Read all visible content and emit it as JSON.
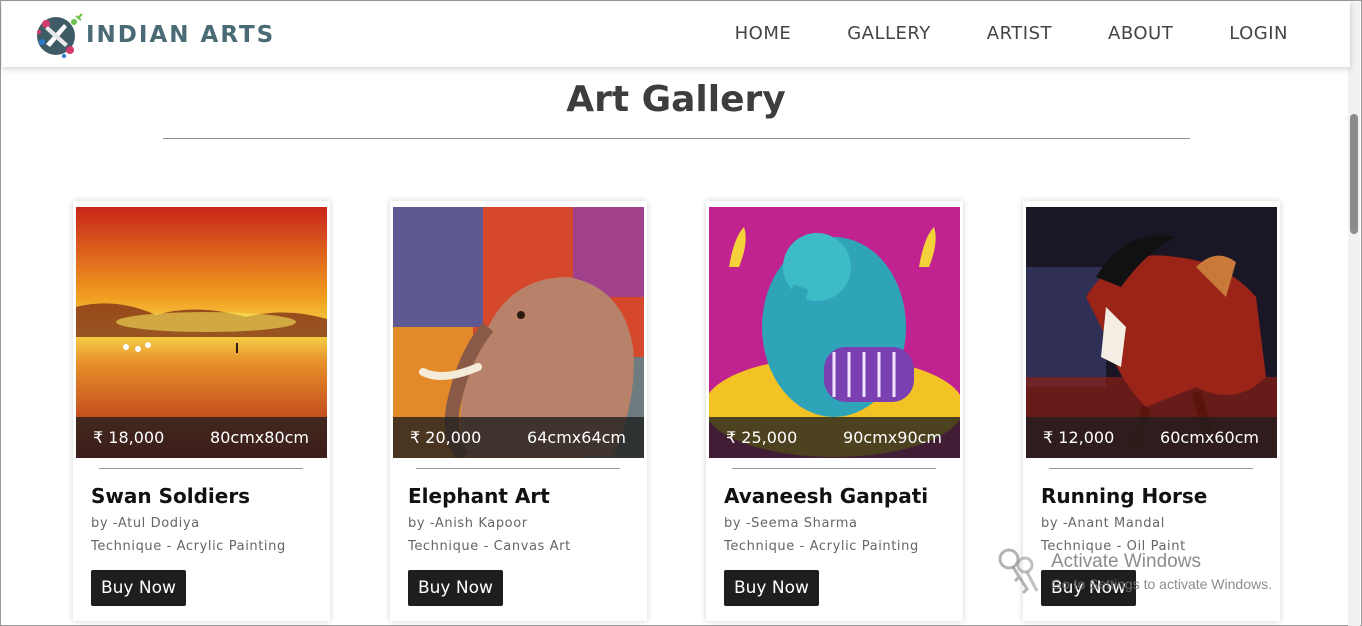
{
  "header": {
    "logo_text": "INDIAN ARTS",
    "nav": [
      "HOME",
      "GALLERY",
      "ARTIST",
      "ABOUT",
      "LOGIN"
    ]
  },
  "page": {
    "title": "Art Gallery"
  },
  "cards": [
    {
      "price": "₹ 18,000",
      "size": "80cmx80cm",
      "title": "Swan Soldiers",
      "artist": "by -Atul Dodiya",
      "technique": "Technique - Acrylic Painting",
      "button": "Buy Now"
    },
    {
      "price": "₹ 20,000",
      "size": "64cmx64cm",
      "title": "Elephant Art",
      "artist": "by -Anish Kapoor",
      "technique": "Technique - Canvas Art",
      "button": "Buy Now"
    },
    {
      "price": "₹ 25,000",
      "size": "90cmx90cm",
      "title": "Avaneesh Ganpati",
      "artist": "by -Seema Sharma",
      "technique": "Technique - Acrylic Painting",
      "button": "Buy Now"
    },
    {
      "price": "₹ 12,000",
      "size": "60cmx60cm",
      "title": "Running Horse",
      "artist": "by -Anant Mandal",
      "technique": "Technique - Oil Paint",
      "button": "Buy Now"
    }
  ],
  "watermark": {
    "title": "Activate Windows",
    "subtitle": "Go to Settings to activate Windows."
  },
  "colors": {
    "logo": "#4a6b75",
    "button_bg": "#1e1e1e",
    "title": "#3d3d3d"
  }
}
